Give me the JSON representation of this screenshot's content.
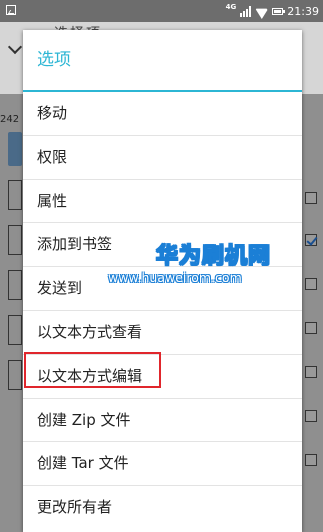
{
  "status_bar": {
    "network": "4G",
    "time": "21:39"
  },
  "background": {
    "title": "选择项",
    "number": "242"
  },
  "dialog": {
    "title": "选项",
    "items": [
      {
        "label": "移动"
      },
      {
        "label": "权限"
      },
      {
        "label": "属性"
      },
      {
        "label": "添加到书签"
      },
      {
        "label": "发送到"
      },
      {
        "label": "以文本方式查看"
      },
      {
        "label": "以文本方式编辑"
      },
      {
        "label": "创建 Zip 文件"
      },
      {
        "label": "创建 Tar 文件"
      },
      {
        "label": "更改所有者"
      }
    ],
    "accent_color": "#2cb6d4"
  },
  "highlight": {
    "item": "以文本方式编辑",
    "color": "#e0262c"
  },
  "watermark": {
    "cn": "华为刷机网",
    "en": "www.huaweirom.com"
  }
}
